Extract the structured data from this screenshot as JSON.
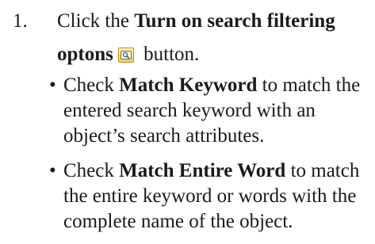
{
  "step": {
    "number": "1.",
    "prefix": "Click the ",
    "button_name_line1": "Turn on search filtering",
    "button_name_line2": "optons",
    "suffix": " button.",
    "icon": "search-filter-icon"
  },
  "bullets": [
    {
      "marker": "•",
      "lead": "Check ",
      "option": "Match Keyword",
      "rest": " to match the entered search keyword with an object’s search attributes."
    },
    {
      "marker": "•",
      "lead": "Check ",
      "option": "Match Entire Word",
      "rest": " to match the entire keyword or words with the complete name of the object."
    }
  ]
}
